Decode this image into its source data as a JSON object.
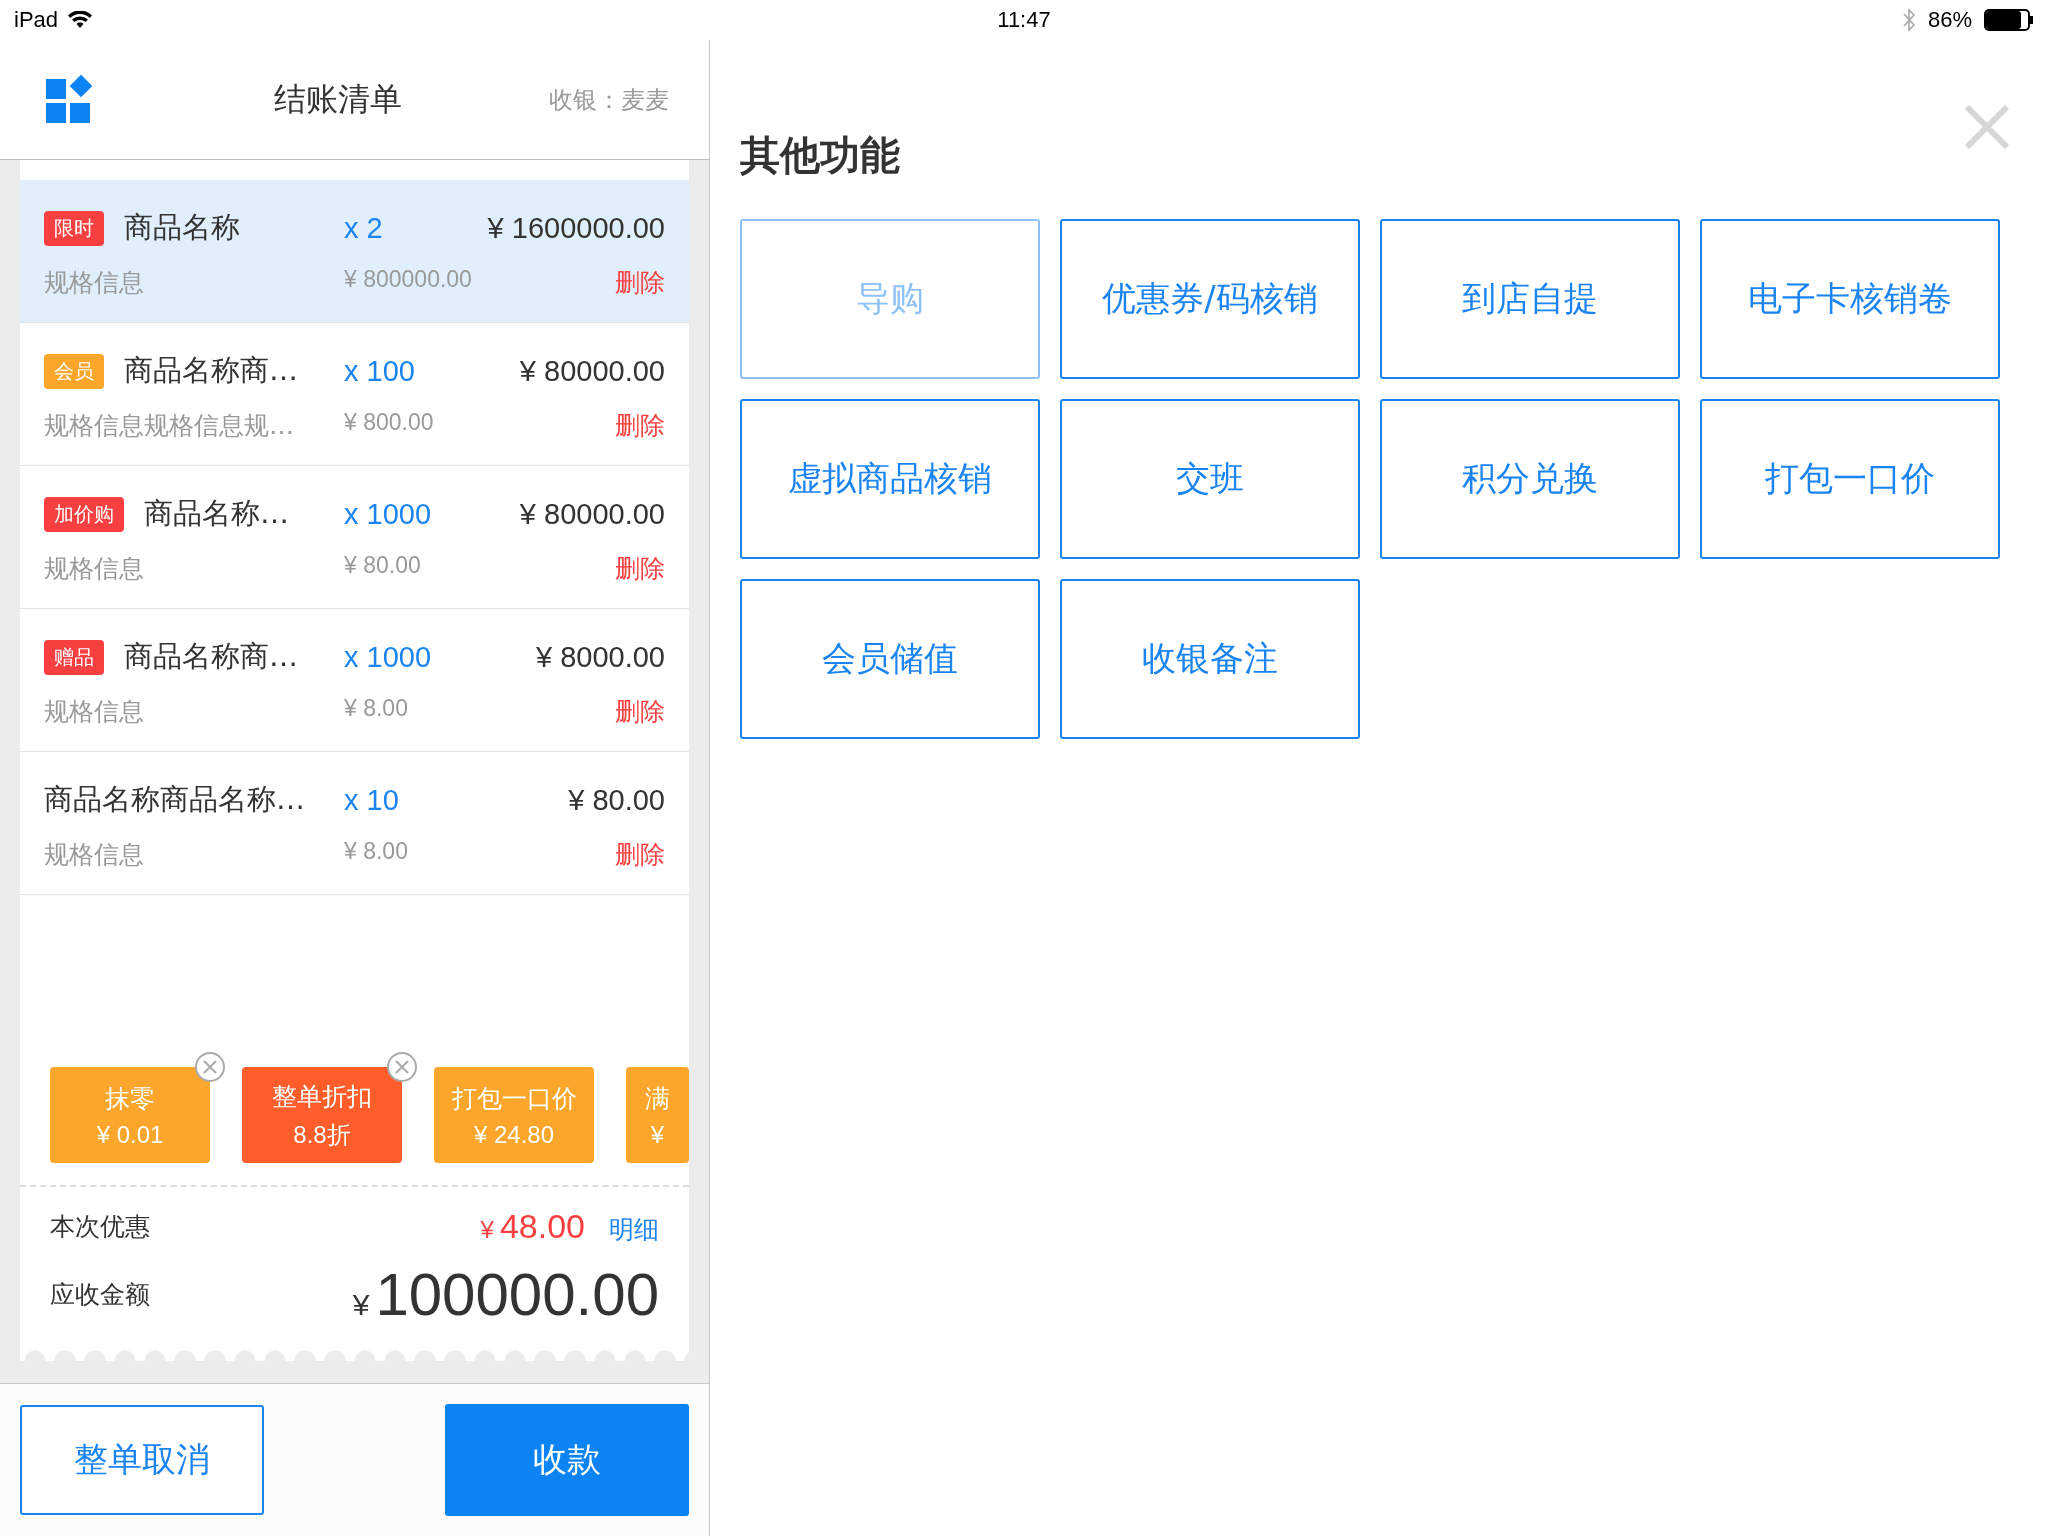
{
  "status_bar": {
    "device": "iPad",
    "time": "11:47",
    "battery": "86%"
  },
  "header": {
    "title": "结账清单",
    "cashier": "收银：麦麦"
  },
  "items": [
    {
      "tag": "限时",
      "color": "#f94040",
      "name": "商品名称",
      "qty": "x 2",
      "total": "¥ 1600000.00",
      "spec": "规格信息",
      "unit_price": "¥ 800000.00",
      "delete": "删除",
      "selected": true
    },
    {
      "tag": "会员",
      "color": "#fca62b",
      "name": "商品名称商…",
      "qty": "x 100",
      "total": "¥ 80000.00",
      "spec": "规格信息规格信息规…",
      "unit_price": "¥ 800.00",
      "delete": "删除",
      "selected": false
    },
    {
      "tag": "加价购",
      "color": "#f94040",
      "name": "商品名称…",
      "qty": "x 1000",
      "total": "¥ 80000.00",
      "spec": "规格信息",
      "unit_price": "¥ 80.00",
      "delete": "删除",
      "selected": false
    },
    {
      "tag": "赠品",
      "color": "#f94040",
      "name": "商品名称商…",
      "qty": "x 1000",
      "total": "¥ 8000.00",
      "spec": "规格信息",
      "unit_price": "¥ 8.00",
      "delete": "删除",
      "selected": false
    },
    {
      "name": "商品名称商品名称…",
      "qty": "x 10",
      "total": "¥ 80.00",
      "spec": "规格信息",
      "unit_price": "¥ 8.00",
      "delete": "删除",
      "selected": false
    }
  ],
  "discounts": [
    {
      "label": "抹零",
      "value": "¥ 0.01",
      "color": "#fca62b",
      "removable": true
    },
    {
      "label": "整单折扣",
      "value": "8.8折",
      "color": "#ff5e2a",
      "removable": true
    },
    {
      "label": "打包一口价",
      "value": "¥ 24.80",
      "color": "#fca62b",
      "removable": false
    },
    {
      "label": "满",
      "value": "¥",
      "color": "#fca62b",
      "removable": false
    }
  ],
  "summary": {
    "discount_label": "本次优惠",
    "discount_currency": "¥",
    "discount_amount": "48.00",
    "detail_link": "明细",
    "due_label": "应收金额",
    "due_currency": "¥",
    "due_amount": "100000.00"
  },
  "actions": {
    "cancel": "整单取消",
    "pay": "收款"
  },
  "panel": {
    "title": "其他功能",
    "functions": [
      {
        "label": "导购",
        "disabled": true
      },
      {
        "label": "优惠券/码核销",
        "disabled": false
      },
      {
        "label": "到店自提",
        "disabled": false
      },
      {
        "label": "电子卡核销卷",
        "disabled": false
      },
      {
        "label": "虚拟商品核销",
        "disabled": false
      },
      {
        "label": "交班",
        "disabled": false
      },
      {
        "label": "积分兑换",
        "disabled": false
      },
      {
        "label": "打包一口价",
        "disabled": false
      },
      {
        "label": "会员储值",
        "disabled": false
      },
      {
        "label": "收银备注",
        "disabled": false
      }
    ]
  }
}
